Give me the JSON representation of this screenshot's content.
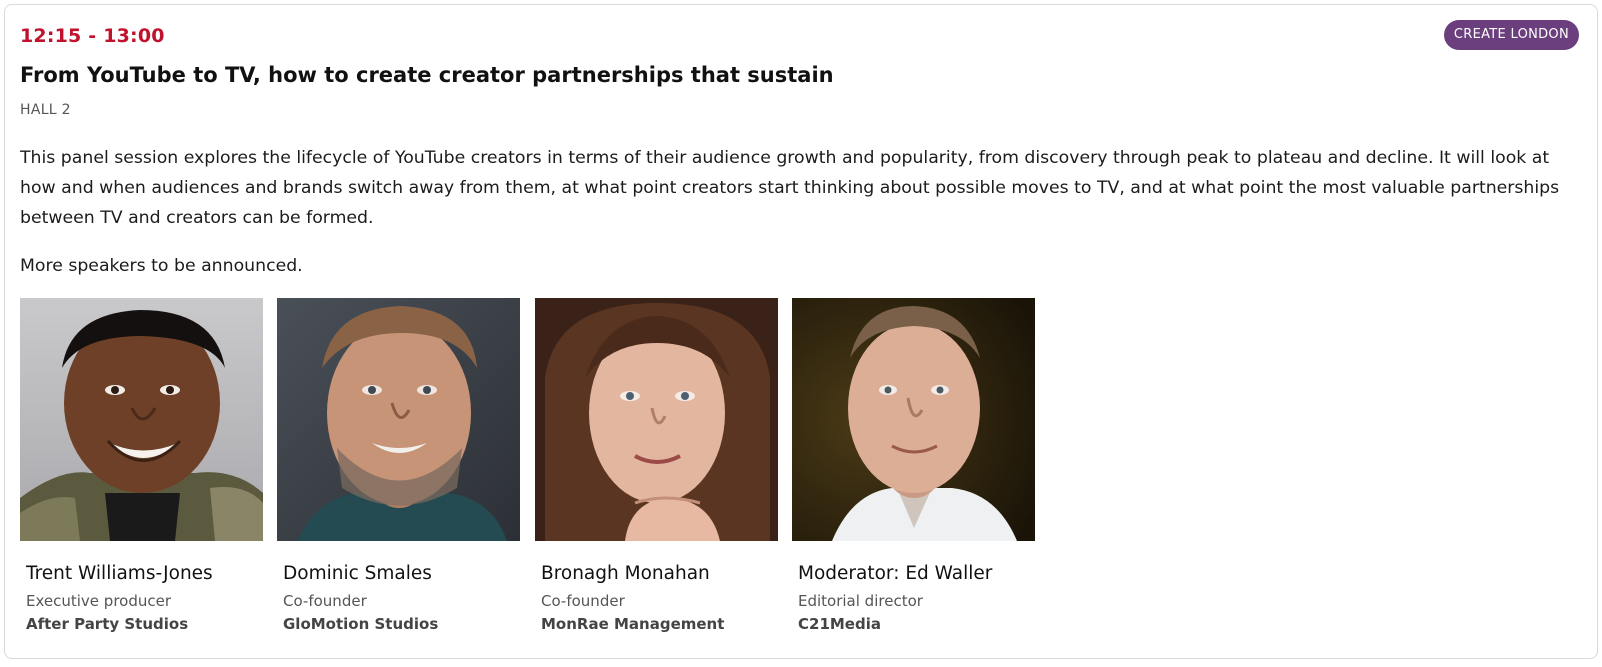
{
  "session": {
    "time": "12:15 - 13:00",
    "tag": "CREATE LONDON",
    "title": "From YouTube to TV, how to create creator partnerships that sustain",
    "room": "HALL 2",
    "description": "This panel session explores the lifecycle of YouTube creators in terms of their audience growth and popularity, from discovery through peak to plateau and decline. It will look at how and when audiences and brands switch away from them, at what point creators start thinking about possible moves to TV, and at what point the most valuable partnerships between TV and creators can be formed.",
    "more": "More speakers to be announced."
  },
  "colors": {
    "time": "#c0122d",
    "tag_bg": "#6b3f7d"
  },
  "speakers": [
    {
      "name": "Trent Williams-Jones",
      "role": "Executive producer",
      "company": "After Party Studios"
    },
    {
      "name": "Dominic Smales",
      "role": "Co-founder",
      "company": "GloMotion Studios"
    },
    {
      "name": "Bronagh Monahan",
      "role": "Co-founder",
      "company": "MonRae Management"
    },
    {
      "name": "Moderator: Ed Waller",
      "role": "Editorial director",
      "company": "C21Media"
    }
  ]
}
